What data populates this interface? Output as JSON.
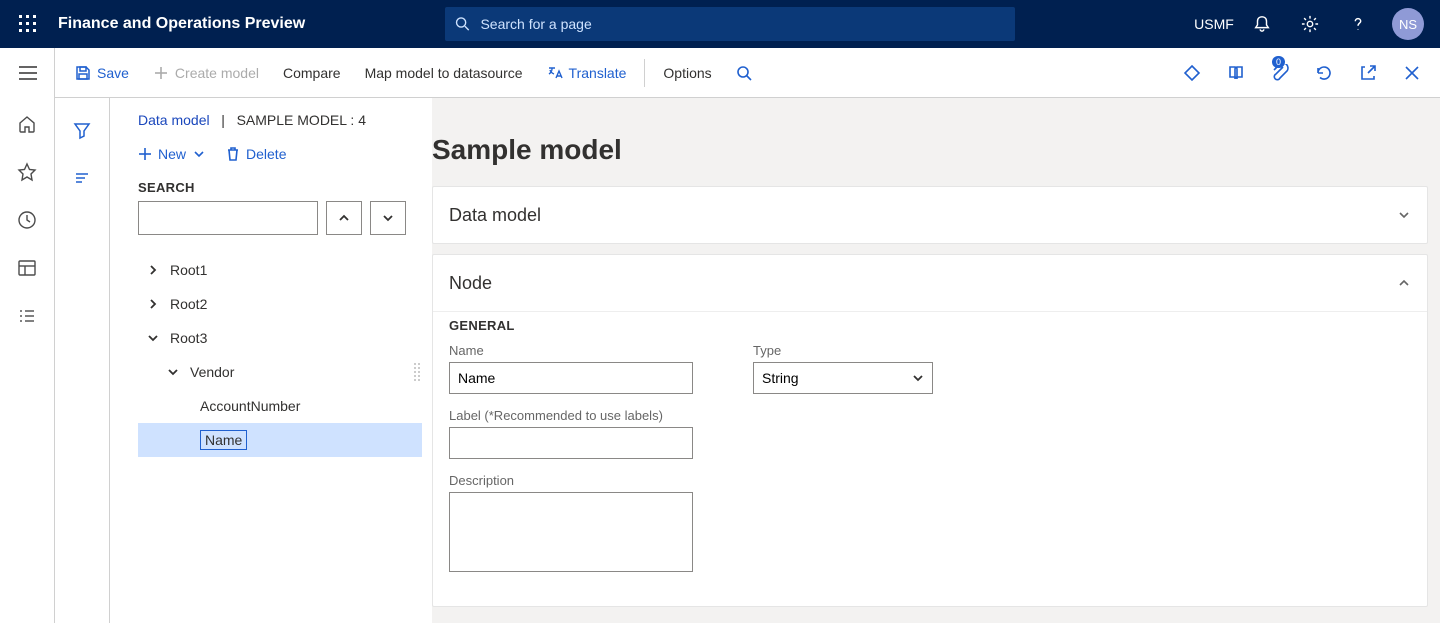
{
  "topnav": {
    "app_title": "Finance and Operations Preview",
    "search_placeholder": "Search for a page",
    "company": "USMF",
    "avatar_initials": "NS"
  },
  "cmdbar": {
    "save": "Save",
    "create_model": "Create model",
    "compare": "Compare",
    "map_model": "Map model to datasource",
    "translate": "Translate",
    "options": "Options",
    "badge_count": "0"
  },
  "panel": {
    "breadcrumb_link": "Data model",
    "breadcrumb_text": "SAMPLE MODEL : 4",
    "new": "New",
    "delete": "Delete",
    "search_label": "SEARCH"
  },
  "tree": {
    "root1": "Root1",
    "root2": "Root2",
    "root3": "Root3",
    "vendor": "Vendor",
    "account_number": "AccountNumber",
    "name": "Name"
  },
  "main": {
    "title": "Sample model",
    "card_data_model_title": "Data model",
    "card_node_title": "Node",
    "section_general": "GENERAL",
    "field_name_label": "Name",
    "field_name_value": "Name",
    "field_label_label": "Label (*Recommended to use labels)",
    "field_label_value": "",
    "field_type_label": "Type",
    "field_type_value": "String",
    "field_desc_label": "Description",
    "field_desc_value": ""
  }
}
